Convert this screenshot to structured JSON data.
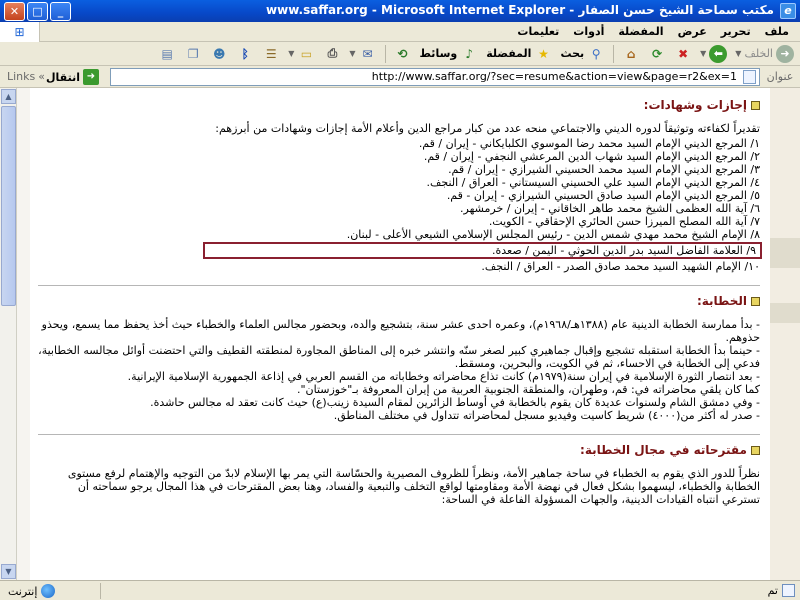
{
  "window": {
    "title": "مكتب سماحة الشيخ حسن الصفار - www.saffar.org - Microsoft Internet Explorer"
  },
  "menu": [
    "ملف",
    "تحرير",
    "عرض",
    "المفضلة",
    "أدوات",
    "تعليمات"
  ],
  "toolbar": {
    "back_label": "الخلف",
    "search_label": "بحث",
    "favorites_label": "المفضلة",
    "media_label": "وسائط"
  },
  "address": {
    "label": "عنوان",
    "url": "http://www.saffar.org/?sec=resume&action=view&page=r2&ex=1",
    "go_label": "انتقال",
    "links_label": "Links"
  },
  "page": {
    "section1": {
      "title": "إجازات وشهادات:",
      "intro": "تقديراً لكفاءته وتوثيقاً لدوره الديني والاجتماعي منحه عدد من كبار مراجع الدين وأعلام الأمة إجازات وشهادات من أبرزهم:",
      "items": [
        "١/ المرجع الديني الإمام السيد محمد رضا الموسوي الكلبايكاني - إيران / قم.",
        "٢/ المرجع الديني الإمام السيد شهاب الدين المرعشي النجفي - إيران / قم.",
        "٣/ المرجع الديني الإمام السيد محمد الحسيني الشيرازي - إيران / قم.",
        "٤/ المرجع الديني الإمام السيد علي الحسيني السيستاني - العراق / النجف.",
        "٥/ المرجع الديني الإمام السيد صادق الحسيني الشيرازي - إيران - قم.",
        "٦/ آية الله العظمى الشيخ محمد طاهر الخاقاني - إيران / خرمشهر.",
        "٧/ آية الله المصلح الميرزا حسن الحائري الإحقاقي - الكويت.",
        "٨/ الإمام الشيخ محمد مهدي شمس الدين - رئيس المجلس الإسلامي الشيعي الأعلى - لبنان.",
        "٩/ العلامة الفاضل السيد بدر الدين الحوثي - اليمن / صعدة.",
        "١٠/ الإمام الشهيد السيد محمد صادق الصدر - العراق / النجف."
      ]
    },
    "section2": {
      "title": "الخطابة:",
      "paras": [
        "- بدأ ممارسة الخطابة الدينية عام (١٣٨٨هـ/١٩٦٨م)، وعمره احدى عشر سنة، بتشجيع والده، وبحضور مجالس العلماء والخطباء حيث أخذ يحفظ مما يسمع، ويحذو حذوهم.",
        "- حينما بدأ الخطابة استقبله تشجيع وإقبال جماهيري كبير لصغر سنّه وانتشر خبره إلى المناطق المجاورة لمنطقته القطيف والتي احتضنت أوائل مجالسه الخطابية، فدعي إلى الخطابة في الاحساء، ثم في الكويت، والبحرين، ومسقط.",
        "- بعد انتصار الثورة الإسلامية في إيران سنة(١٩٧٩م) كانت تذاع محاضراته وخطاباته من القسم العربي في إذاعة الجمهورية الإسلامية الإيرانية.",
        "كما كان يلقي محاضراته في: قم، وطهران، والمنطقة الجنوبية العربية من إيران المعروفة بـ\"خوزستان\".",
        "- وفي دمشق الشام ولسنوات عديدة كان يقوم بالخطابة في أوساط الزائرين لمقام السيدة زينب(ع) حيث كانت تعقد له مجالس حاشدة.",
        "- صدر له أكثر من(٤٠٠٠) شريط كاسيت وفيديو مسجل لمحاضراته تتداول في مختلف المناطق."
      ]
    },
    "section3": {
      "title": "مقترحاته في مجال الخطابة:",
      "intro": "نظراً للدور الذي يقوم به الخطباء في ساحة جماهير الأمة، ونظراً للظروف المصيرية والحسّاسة التي يمر بها الإسلام لابدّ من التوجيه والإهتمام لرفع مستوى الخطابة والخطباء، ليسهموا بشكل فعال في نهضة الأمة ومقاومتها لواقع التخلف والتبعية والفساد، وهنا بعض المقترحات في هذا المجال يرجو سماحته أن تسترعي انتباه القيادات الدينية، والجهات المسؤولة الفاعلة في الساحة:"
    }
  },
  "status": {
    "text": "تم",
    "zone": "إنترنت"
  }
}
